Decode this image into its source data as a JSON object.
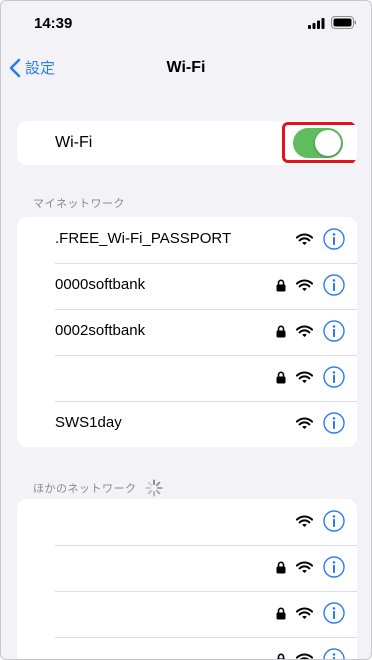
{
  "status": {
    "time": "14:39"
  },
  "nav": {
    "back_label": "設定",
    "title": "Wi-Fi"
  },
  "wifi_toggle": {
    "label": "Wi-Fi",
    "on": true,
    "on_color": "#5fbd5f",
    "highlight_color": "#e0141e"
  },
  "my_networks": {
    "header": "マイネットワーク",
    "items": [
      {
        "name": ".FREE_Wi-Fi_PASSPORT",
        "locked": false
      },
      {
        "name": "0000softbank",
        "locked": true
      },
      {
        "name": "0002softbank",
        "locked": true
      },
      {
        "name": "",
        "locked": true
      },
      {
        "name": "SWS1day",
        "locked": false
      }
    ]
  },
  "other_networks": {
    "header": "ほかのネットワーク",
    "items": [
      {
        "name": "",
        "locked": false
      },
      {
        "name": "",
        "locked": true
      },
      {
        "name": "",
        "locked": true
      },
      {
        "name": "",
        "locked": true
      }
    ]
  },
  "colors": {
    "accent": "#2c7bf6",
    "background": "#f2f2f7"
  }
}
